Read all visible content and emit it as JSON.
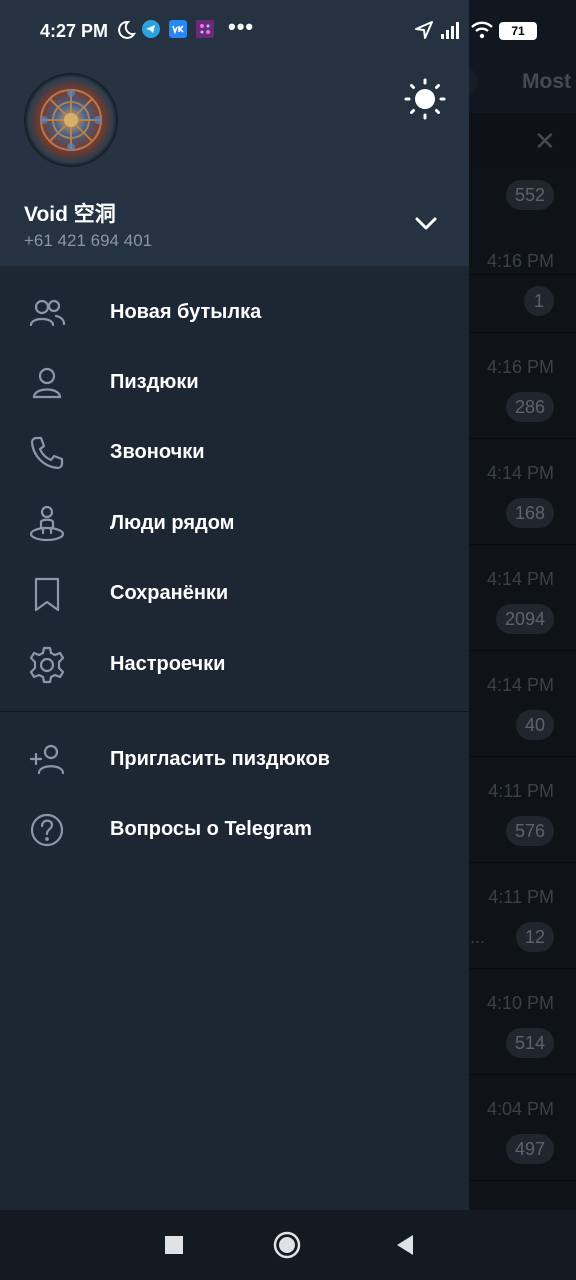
{
  "status_bar": {
    "time": "4:27 PM",
    "more": "•••",
    "battery": "71"
  },
  "background": {
    "tab_most": "Most",
    "rows": [
      {
        "time": "",
        "badge": "552"
      },
      {
        "time": "4:16 PM",
        "badge": "1"
      },
      {
        "time": "4:16 PM",
        "badge": "286"
      },
      {
        "time": "4:14 PM",
        "badge": "168"
      },
      {
        "time": "4:14 PM",
        "badge": "2094"
      },
      {
        "time": "4:14 PM",
        "badge": "40"
      },
      {
        "time": "4:11 PM",
        "badge": "576"
      },
      {
        "time": "4:11 PM",
        "badge": "12",
        "ellipsis": "..."
      },
      {
        "time": "4:10 PM",
        "badge": "514"
      },
      {
        "time": "4:04 PM",
        "badge": "497"
      }
    ]
  },
  "drawer": {
    "user": {
      "name": "Void 空洞",
      "phone": "+61 421 694 401"
    },
    "menu": [
      {
        "label": "Новая бутылка",
        "icon": "new-group-icon"
      },
      {
        "label": "Пиздюки",
        "icon": "contacts-icon"
      },
      {
        "label": "Звоночки",
        "icon": "calls-icon"
      },
      {
        "label": "Люди рядом",
        "icon": "people-nearby-icon"
      },
      {
        "label": "Сохранёнки",
        "icon": "saved-messages-icon"
      },
      {
        "label": "Настроечки",
        "icon": "settings-icon"
      }
    ],
    "menu_secondary": [
      {
        "label": "Пригласить пиздюков",
        "icon": "invite-friends-icon"
      },
      {
        "label": "Вопросы о Telegram",
        "icon": "help-icon"
      }
    ]
  },
  "colors": {
    "drawer_bg": "#1d2733",
    "header_bg": "#243241",
    "icon_color": "#8a98a8",
    "text_primary": "#ffffff",
    "text_secondary": "#8796a6"
  }
}
